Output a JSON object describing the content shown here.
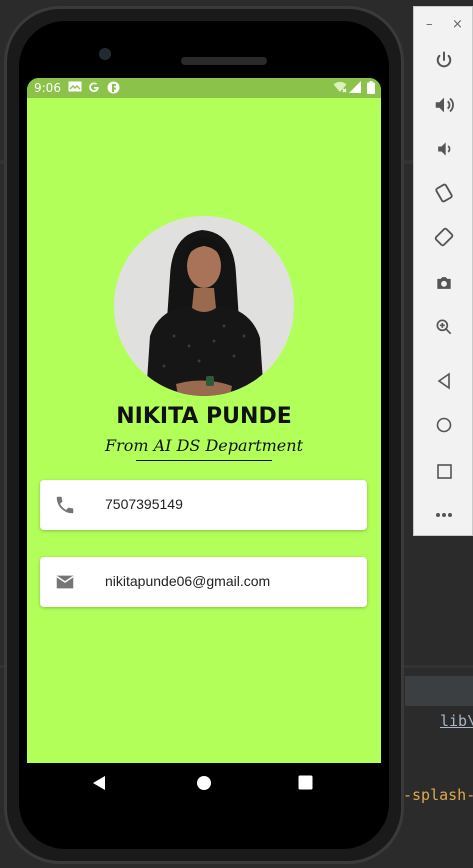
{
  "ide": {
    "code_line_1": "lib\\",
    "code_line_2": "-splash-"
  },
  "side_toolbar": {
    "minimize": "–",
    "close": "×",
    "buttons": [
      "power-icon",
      "volume-up-icon",
      "volume-down-icon",
      "rotate-left-icon",
      "rotate-right-icon",
      "camera-icon",
      "zoom-icon",
      "back-icon",
      "home-icon",
      "overview-icon",
      "more-icon"
    ]
  },
  "status_bar": {
    "time": "9:06",
    "icons": [
      "mail-icon",
      "google-icon",
      "app-icon",
      "wifi-icon",
      "signal-icon",
      "battery-icon"
    ]
  },
  "profile": {
    "name": "NIKITA PUNDE",
    "subtitle": "From AI DS Department"
  },
  "contacts": {
    "phone": {
      "icon": "phone-icon",
      "value": "7507395149"
    },
    "email": {
      "icon": "email-icon",
      "value": "nikitapunde06@gmail.com"
    }
  },
  "colors": {
    "background": "#b2ff59",
    "status_bar": "#8bc34a",
    "card": "#ffffff",
    "icon_gray": "#757575"
  }
}
